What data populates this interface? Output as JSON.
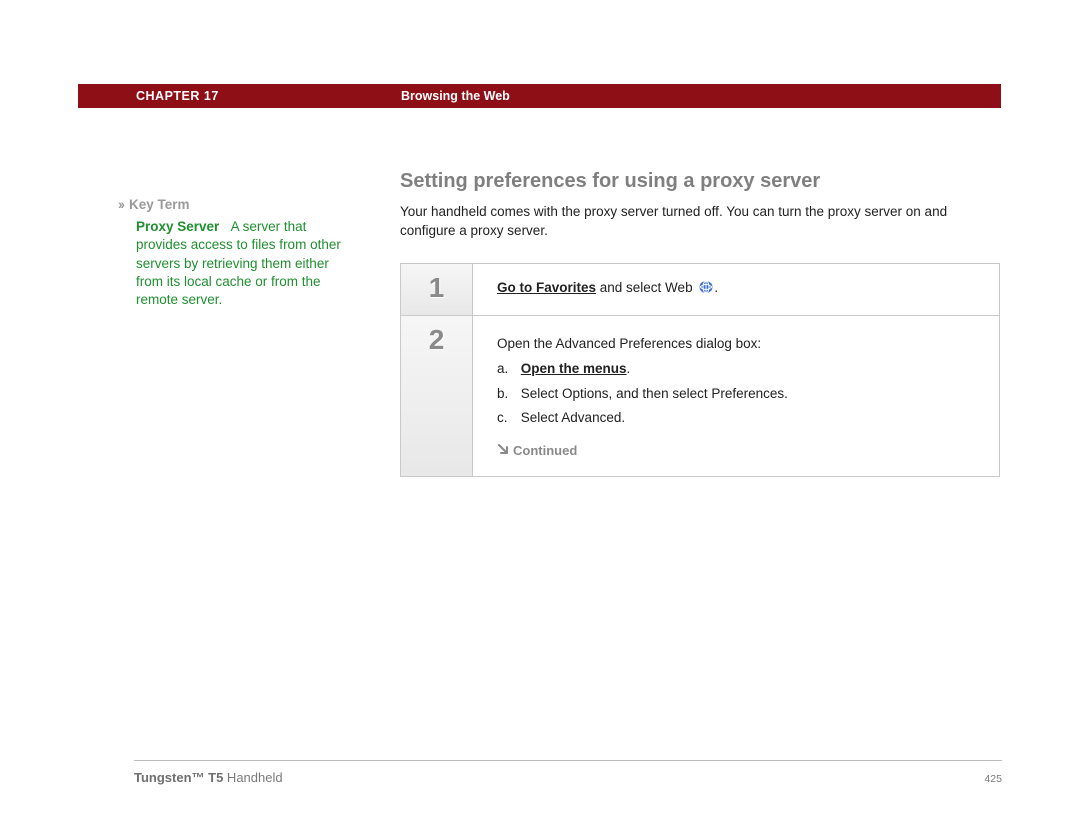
{
  "header": {
    "chapter": "CHAPTER 17",
    "title": "Browsing the Web"
  },
  "sidebar": {
    "key_term_label": "Key Term",
    "term": "Proxy Server",
    "definition": "A server that provides access to files from other servers by retrieving them either from its local cache or from the remote server."
  },
  "main": {
    "section_title": "Setting preferences for using a proxy server",
    "intro": "Your handheld comes with the proxy server turned off. You can turn the proxy server on and configure a proxy server.",
    "steps": [
      {
        "num": "1",
        "favorites_link": "Go to Favorites",
        "favorites_rest": " and select Web ",
        "period": "."
      },
      {
        "num": "2",
        "lead": "Open the Advanced Preferences dialog box:",
        "a_label": "a.",
        "a_text": "Open the menus",
        "a_period": ".",
        "b_label": "b.",
        "b_text": "Select Options, and then select Preferences.",
        "c_label": "c.",
        "c_text": "Select Advanced.",
        "continued": "Continued"
      }
    ]
  },
  "footer": {
    "product_bold": "Tungsten™ T5",
    "product_rest": " Handheld",
    "page": "425"
  }
}
